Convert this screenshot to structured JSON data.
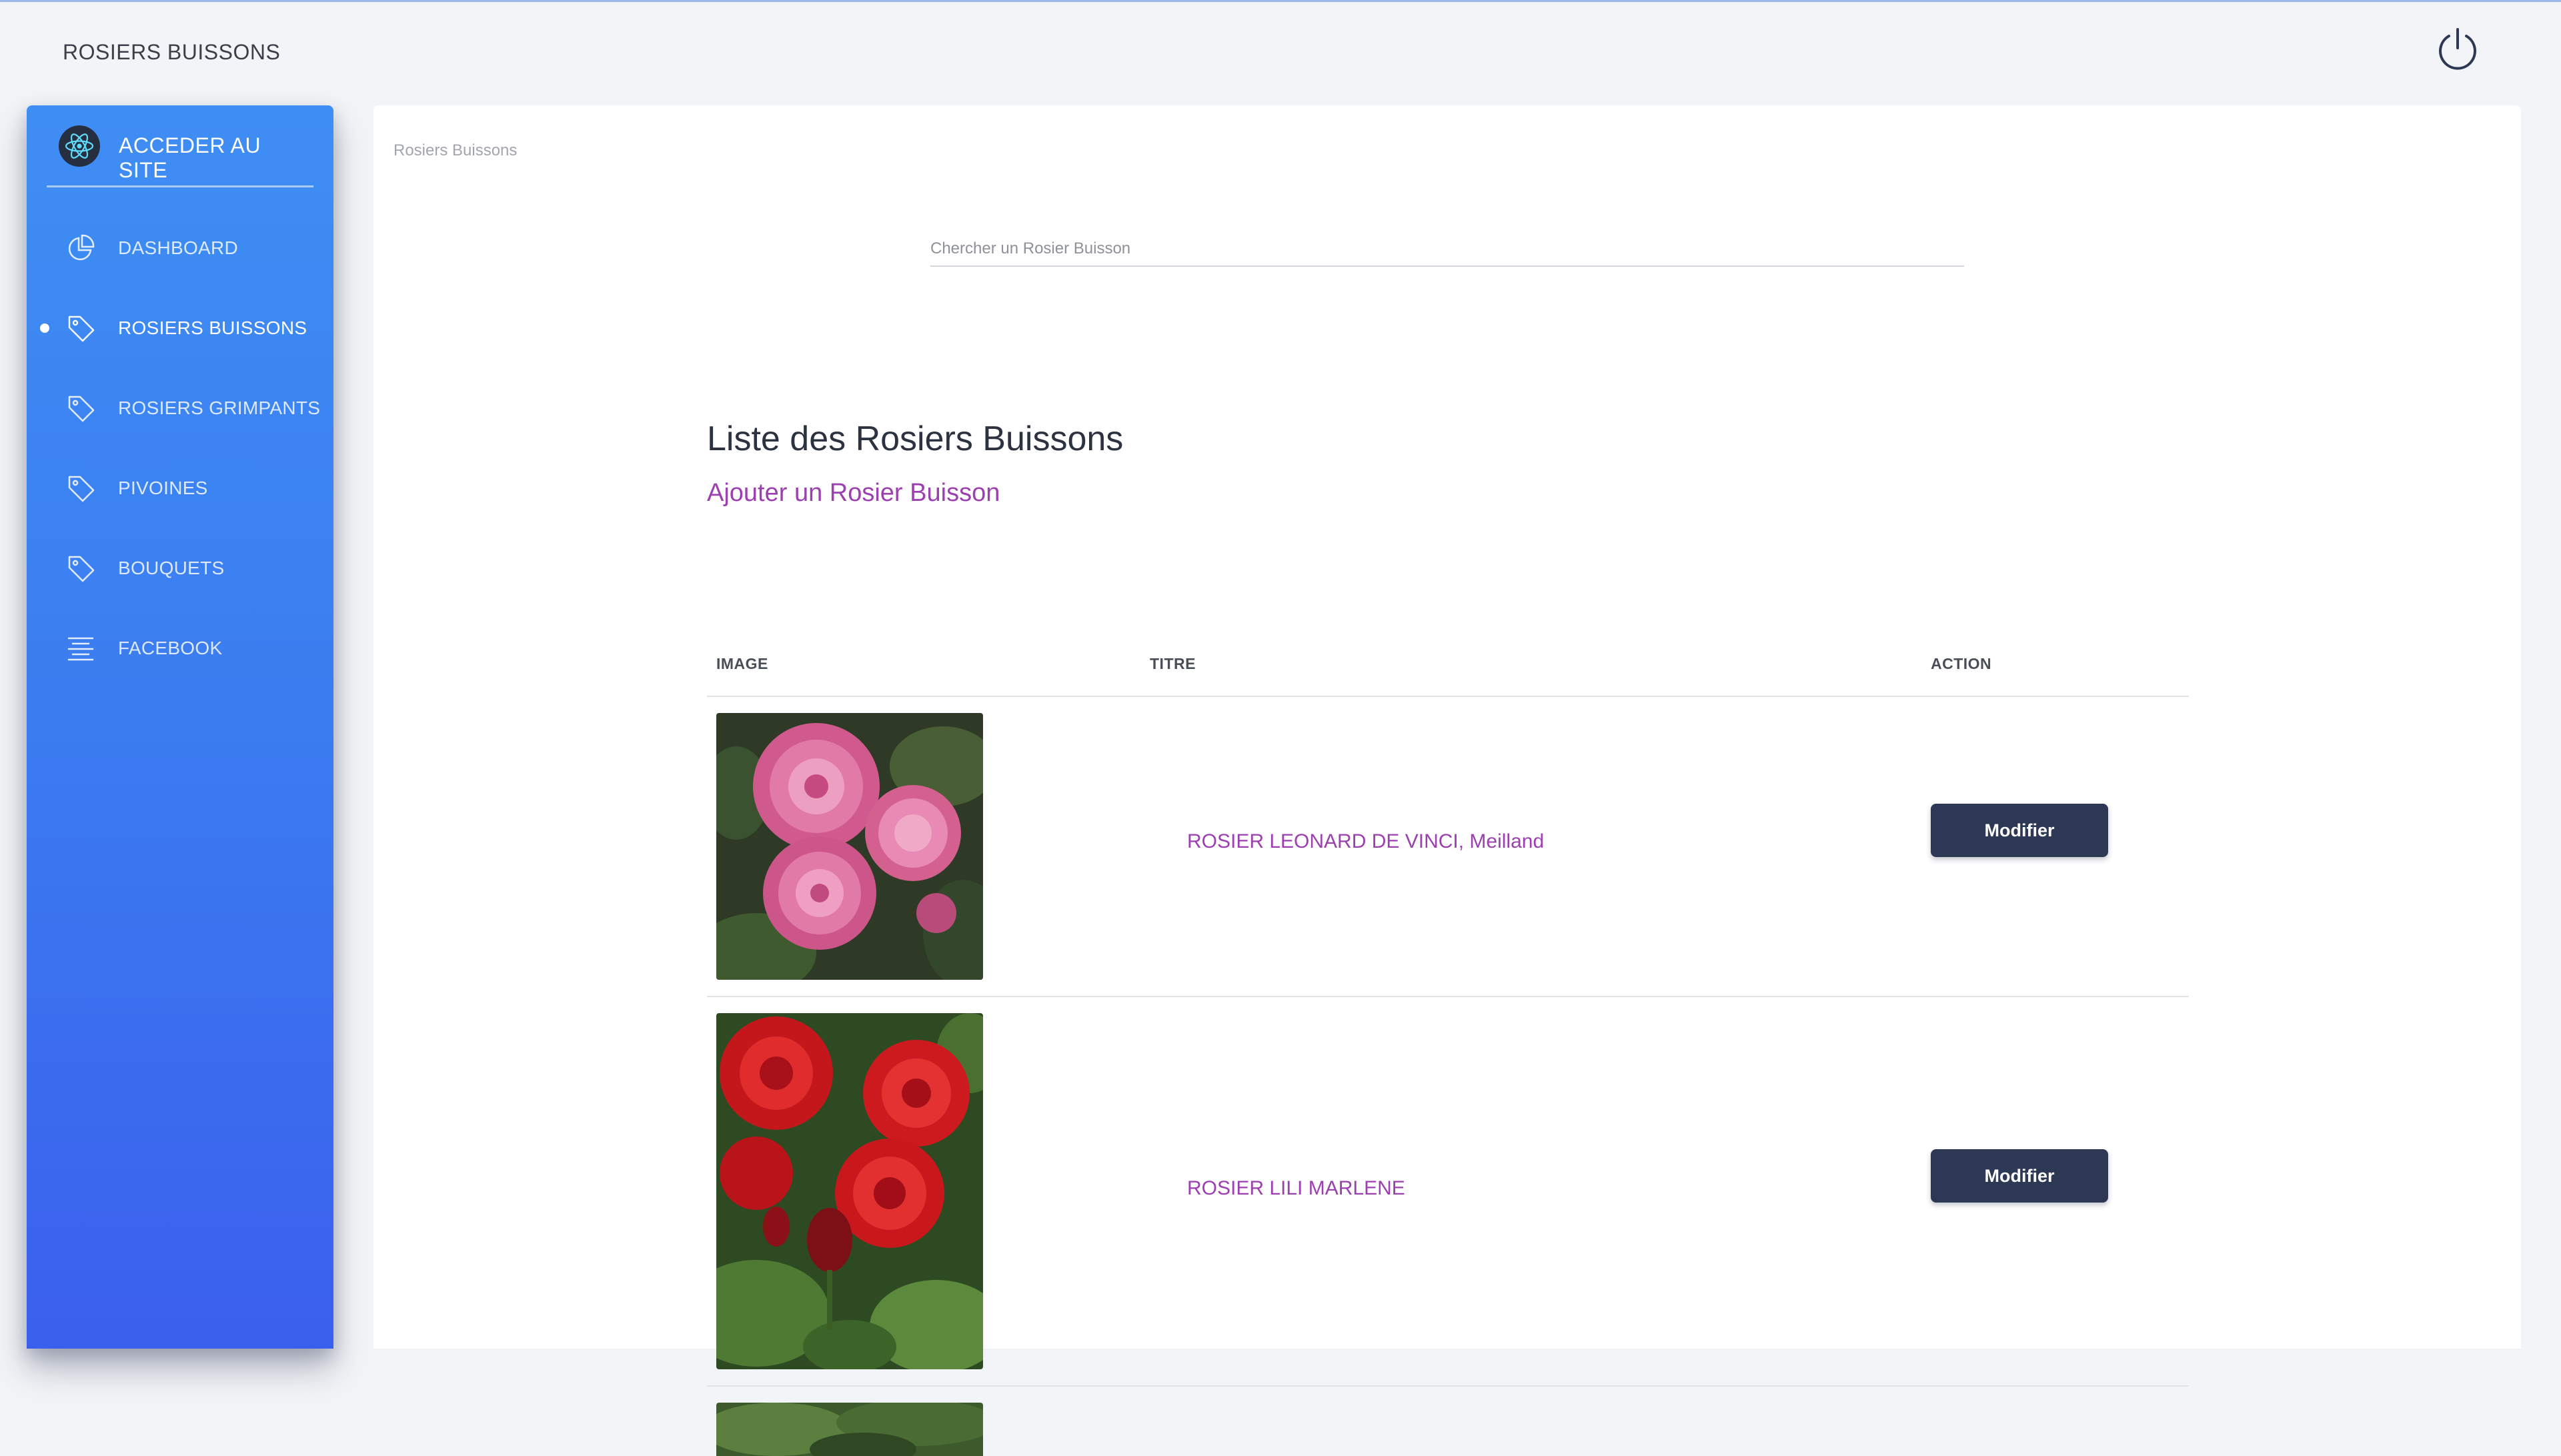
{
  "header": {
    "title": "ROSIERS BUISSONS",
    "power_icon": "power-icon"
  },
  "sidebar": {
    "brand_label": "ACCEDER AU SITE",
    "brand_icon": "react-atom-icon",
    "items": [
      {
        "label": "DASHBOARD",
        "icon": "pie-chart-icon",
        "active": false
      },
      {
        "label": "ROSIERS BUISSONS",
        "icon": "tag-icon",
        "active": true
      },
      {
        "label": "ROSIERS GRIMPANTS",
        "icon": "tag-icon",
        "active": false
      },
      {
        "label": "PIVOINES",
        "icon": "tag-icon",
        "active": false
      },
      {
        "label": "BOUQUETS",
        "icon": "tag-icon",
        "active": false
      },
      {
        "label": "FACEBOOK",
        "icon": "align-center-icon",
        "active": false
      }
    ],
    "colors": {
      "top": "#3f8ef4",
      "bottom": "#3b5fed"
    }
  },
  "main": {
    "breadcrumb": "Rosiers Buissons",
    "search": {
      "placeholder": "Chercher un Rosier Buisson",
      "value": ""
    },
    "list_title": "Liste des Rosiers Buissons",
    "add_link": "Ajouter un Rosier Buisson",
    "table": {
      "columns": [
        "IMAGE",
        "TITRE",
        "ACTION"
      ],
      "rows": [
        {
          "image": "pink-rose-photo",
          "title": "ROSIER LEONARD DE VINCI, Meilland",
          "action": "Modifier"
        },
        {
          "image": "red-rose-photo",
          "title": "ROSIER LILI MARLENE",
          "action": "Modifier"
        },
        {
          "image": "green-foliage-photo",
          "title": "",
          "action": ""
        }
      ]
    },
    "colors": {
      "link": "#9c3fb0",
      "button": "#2d3855"
    }
  }
}
